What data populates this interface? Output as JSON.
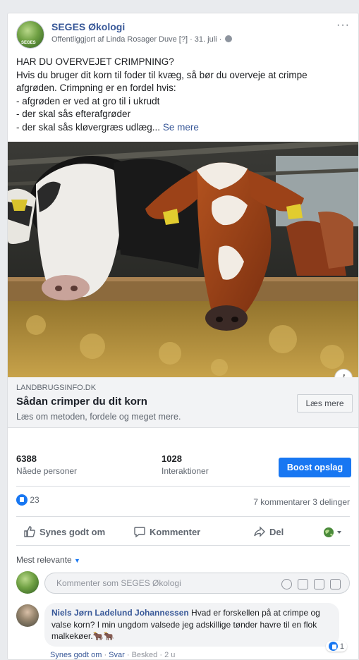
{
  "post": {
    "page_name": "SEGES Økologi",
    "avatar_text": "SEGES",
    "meta": "Offentliggjort af Linda Rosager Duve [?] · 31. juli ·",
    "more_icon": "···",
    "text_lines": [
      "HAR DU OVERVEJET CRIMPNING?",
      "Hvis du bruger dit korn til foder til kvæg, så bør du overveje at crimpe",
      "afgrøden. Crimpning er en fordel hvis:",
      "- afgrøden er ved at gro til i ukrudt",
      "- der skal sås efterafgrøder",
      "- der skal sås kløvergræs udlæg..."
    ],
    "see_more": "Se mere"
  },
  "link": {
    "domain": "LANDBRUGSINFO.DK",
    "title": "Sådan crimper du dit korn",
    "description": "Læs om metoden, fordele og meget mere.",
    "button": "Læs mere",
    "info_icon": "i"
  },
  "stats": {
    "reached_value": "6388",
    "reached_label": "Nåede personer",
    "interactions_value": "1028",
    "interactions_label": "Interaktioner",
    "boost_button": "Boost opslag"
  },
  "reactions": {
    "likes": "23",
    "summary": "7 kommentarer  3 delinger"
  },
  "actions": {
    "like": "Synes godt om",
    "comment": "Kommenter",
    "share": "Del"
  },
  "comments": {
    "sort_label": "Mest relevante",
    "input_placeholder": "Kommenter som SEGES Økologi",
    "items": [
      {
        "author": "Niels Jørn Ladelund Johannessen",
        "text": " Hvad er forskellen på at crimpe og valse korn? I min ungdom valsede jeg adskillige tønder havre til en flok malkekøer.🐂🐂",
        "reaction_count": "1",
        "like": "Synes godt om",
        "reply": "Svar",
        "message": "Besked",
        "time": "2 u"
      }
    ]
  },
  "colors": {
    "link_blue": "#385898",
    "boost_blue": "#1877f2",
    "background": "#e9ebee"
  }
}
